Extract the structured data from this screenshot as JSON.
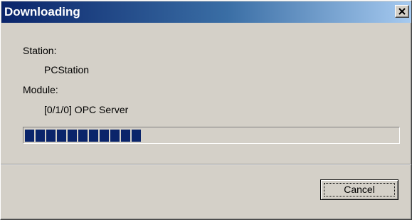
{
  "dialog": {
    "title": "Downloading",
    "close_icon": "close-icon",
    "station_label": "Station:",
    "station_value": "PCStation",
    "module_label": "Module:",
    "module_value": "[0/1/0] OPC Server",
    "progress_percent": 32,
    "cancel_label": "Cancel"
  },
  "colors": {
    "title_gradient_start": "#0a246a",
    "title_gradient_end": "#a6caf0",
    "progress_block": "#0a246a",
    "face": "#d4d0c8"
  }
}
